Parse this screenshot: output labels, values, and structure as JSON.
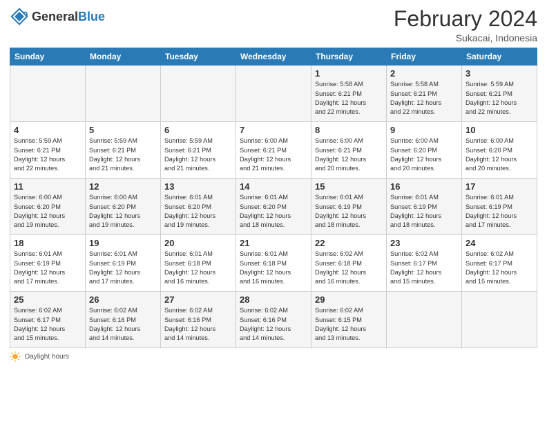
{
  "header": {
    "logo_general": "General",
    "logo_blue": "Blue",
    "month_title": "February 2024",
    "location": "Sukacai, Indonesia"
  },
  "days_of_week": [
    "Sunday",
    "Monday",
    "Tuesday",
    "Wednesday",
    "Thursday",
    "Friday",
    "Saturday"
  ],
  "footer": {
    "daylight_label": "Daylight hours"
  },
  "weeks": [
    {
      "days": [
        {
          "num": "",
          "info": ""
        },
        {
          "num": "",
          "info": ""
        },
        {
          "num": "",
          "info": ""
        },
        {
          "num": "",
          "info": ""
        },
        {
          "num": "1",
          "info": "Sunrise: 5:58 AM\nSunset: 6:21 PM\nDaylight: 12 hours\nand 22 minutes."
        },
        {
          "num": "2",
          "info": "Sunrise: 5:58 AM\nSunset: 6:21 PM\nDaylight: 12 hours\nand 22 minutes."
        },
        {
          "num": "3",
          "info": "Sunrise: 5:59 AM\nSunset: 6:21 PM\nDaylight: 12 hours\nand 22 minutes."
        }
      ]
    },
    {
      "days": [
        {
          "num": "4",
          "info": "Sunrise: 5:59 AM\nSunset: 6:21 PM\nDaylight: 12 hours\nand 22 minutes."
        },
        {
          "num": "5",
          "info": "Sunrise: 5:59 AM\nSunset: 6:21 PM\nDaylight: 12 hours\nand 21 minutes."
        },
        {
          "num": "6",
          "info": "Sunrise: 5:59 AM\nSunset: 6:21 PM\nDaylight: 12 hours\nand 21 minutes."
        },
        {
          "num": "7",
          "info": "Sunrise: 6:00 AM\nSunset: 6:21 PM\nDaylight: 12 hours\nand 21 minutes."
        },
        {
          "num": "8",
          "info": "Sunrise: 6:00 AM\nSunset: 6:21 PM\nDaylight: 12 hours\nand 20 minutes."
        },
        {
          "num": "9",
          "info": "Sunrise: 6:00 AM\nSunset: 6:20 PM\nDaylight: 12 hours\nand 20 minutes."
        },
        {
          "num": "10",
          "info": "Sunrise: 6:00 AM\nSunset: 6:20 PM\nDaylight: 12 hours\nand 20 minutes."
        }
      ]
    },
    {
      "days": [
        {
          "num": "11",
          "info": "Sunrise: 6:00 AM\nSunset: 6:20 PM\nDaylight: 12 hours\nand 19 minutes."
        },
        {
          "num": "12",
          "info": "Sunrise: 6:00 AM\nSunset: 6:20 PM\nDaylight: 12 hours\nand 19 minutes."
        },
        {
          "num": "13",
          "info": "Sunrise: 6:01 AM\nSunset: 6:20 PM\nDaylight: 12 hours\nand 19 minutes."
        },
        {
          "num": "14",
          "info": "Sunrise: 6:01 AM\nSunset: 6:20 PM\nDaylight: 12 hours\nand 18 minutes."
        },
        {
          "num": "15",
          "info": "Sunrise: 6:01 AM\nSunset: 6:19 PM\nDaylight: 12 hours\nand 18 minutes."
        },
        {
          "num": "16",
          "info": "Sunrise: 6:01 AM\nSunset: 6:19 PM\nDaylight: 12 hours\nand 18 minutes."
        },
        {
          "num": "17",
          "info": "Sunrise: 6:01 AM\nSunset: 6:19 PM\nDaylight: 12 hours\nand 17 minutes."
        }
      ]
    },
    {
      "days": [
        {
          "num": "18",
          "info": "Sunrise: 6:01 AM\nSunset: 6:19 PM\nDaylight: 12 hours\nand 17 minutes."
        },
        {
          "num": "19",
          "info": "Sunrise: 6:01 AM\nSunset: 6:19 PM\nDaylight: 12 hours\nand 17 minutes."
        },
        {
          "num": "20",
          "info": "Sunrise: 6:01 AM\nSunset: 6:18 PM\nDaylight: 12 hours\nand 16 minutes."
        },
        {
          "num": "21",
          "info": "Sunrise: 6:01 AM\nSunset: 6:18 PM\nDaylight: 12 hours\nand 16 minutes."
        },
        {
          "num": "22",
          "info": "Sunrise: 6:02 AM\nSunset: 6:18 PM\nDaylight: 12 hours\nand 16 minutes."
        },
        {
          "num": "23",
          "info": "Sunrise: 6:02 AM\nSunset: 6:17 PM\nDaylight: 12 hours\nand 15 minutes."
        },
        {
          "num": "24",
          "info": "Sunrise: 6:02 AM\nSunset: 6:17 PM\nDaylight: 12 hours\nand 15 minutes."
        }
      ]
    },
    {
      "days": [
        {
          "num": "25",
          "info": "Sunrise: 6:02 AM\nSunset: 6:17 PM\nDaylight: 12 hours\nand 15 minutes."
        },
        {
          "num": "26",
          "info": "Sunrise: 6:02 AM\nSunset: 6:16 PM\nDaylight: 12 hours\nand 14 minutes."
        },
        {
          "num": "27",
          "info": "Sunrise: 6:02 AM\nSunset: 6:16 PM\nDaylight: 12 hours\nand 14 minutes."
        },
        {
          "num": "28",
          "info": "Sunrise: 6:02 AM\nSunset: 6:16 PM\nDaylight: 12 hours\nand 14 minutes."
        },
        {
          "num": "29",
          "info": "Sunrise: 6:02 AM\nSunset: 6:15 PM\nDaylight: 12 hours\nand 13 minutes."
        },
        {
          "num": "",
          "info": ""
        },
        {
          "num": "",
          "info": ""
        }
      ]
    }
  ]
}
